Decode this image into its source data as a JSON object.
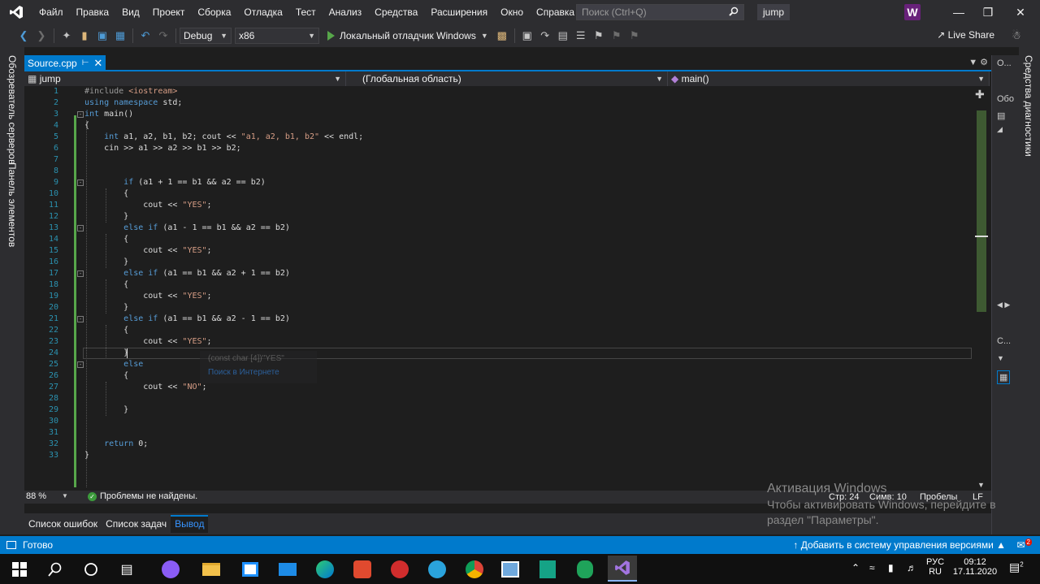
{
  "menu": {
    "items": [
      "Файл",
      "Правка",
      "Вид",
      "Проект",
      "Сборка",
      "Отладка",
      "Тест",
      "Анализ",
      "Средства",
      "Расширения",
      "Окно",
      "Справка"
    ],
    "search_placeholder": "Поиск (Ctrl+Q)",
    "solution_name": "jump",
    "avatar_letter": "W"
  },
  "toolbar": {
    "config": "Debug",
    "platform": "x86",
    "run_label": "Локальный отладчик Windows",
    "live_share": "Live Share"
  },
  "left_tabs": [
    "Обозреватель серверов",
    "Панель элементов"
  ],
  "right_tabs": [
    "Средства диагностики"
  ],
  "document": {
    "tab_name": "Source.cpp",
    "nav_project": "jump",
    "nav_scope": "(Глобальная область)",
    "nav_member": "main()"
  },
  "code": {
    "line_numbers": [
      "1",
      "2",
      "3",
      "4",
      "5",
      "6",
      "7",
      "8",
      "9",
      "10",
      "11",
      "12",
      "13",
      "14",
      "15",
      "16",
      "17",
      "18",
      "19",
      "20",
      "21",
      "22",
      "23",
      "24",
      "25",
      "26",
      "27",
      "28",
      "29",
      "30",
      "31",
      "32",
      "33"
    ]
  },
  "tooltip": {
    "signature": "(const char [4])\"YES\"",
    "link": "Поиск в Интернете"
  },
  "editor_status": {
    "zoom": "88 %",
    "problems": "Проблемы не найдены.",
    "line": "Стр: 24",
    "col": "Симв: 10",
    "whitespace": "Пробелы",
    "eol": "LF"
  },
  "bottom_tabs": [
    "Список ошибок",
    "Список задач",
    "Вывод"
  ],
  "right_panel": {
    "item1": "О...",
    "item2": "Обо",
    "item3": "С..."
  },
  "statusbar": {
    "ready": "Готово",
    "vcs": "Добавить в систему управления версиями",
    "notifications": "2"
  },
  "activation": {
    "title": "Активация Windows",
    "line1": "Чтобы активировать Windows, перейдите в",
    "line2": "раздел \"Параметры\"."
  },
  "taskbar": {
    "lang": "РУС",
    "layout": "RU",
    "time": "09:12",
    "date": "17.11.2020",
    "notif_count": "2"
  }
}
